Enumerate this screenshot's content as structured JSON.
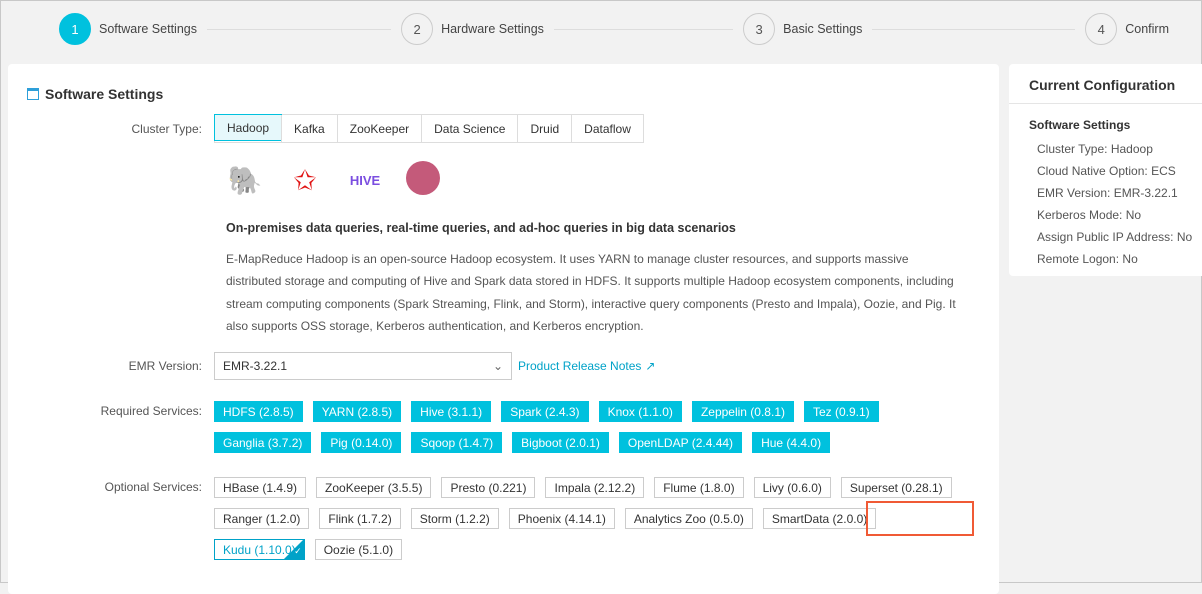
{
  "steps": [
    {
      "num": "1",
      "label": "Software Settings"
    },
    {
      "num": "2",
      "label": "Hardware Settings"
    },
    {
      "num": "3",
      "label": "Basic Settings"
    },
    {
      "num": "4",
      "label": "Confirm"
    }
  ],
  "main": {
    "title": "Software Settings",
    "cluster_type_label": "Cluster Type:",
    "cluster_types": [
      "Hadoop",
      "Kafka",
      "ZooKeeper",
      "Data Science",
      "Druid",
      "Dataflow"
    ],
    "heading": "On-premises data queries, real-time queries, and ad-hoc queries in big data scenarios",
    "description": "E-MapReduce Hadoop is an open-source Hadoop ecosystem. It uses YARN to manage cluster resources, and supports massive distributed storage and computing of Hive and Spark data stored in HDFS. It supports multiple Hadoop ecosystem components, including stream computing components (Spark Streaming, Flink, and Storm), interactive query components (Presto and Impala), Oozie, and Pig. It also supports OSS storage, Kerberos authentication, and Kerberos encryption.",
    "emr_version_label": "EMR Version:",
    "emr_version": "EMR-3.22.1",
    "release_notes": "Product Release Notes",
    "required_label": "Required Services:",
    "required": [
      "HDFS (2.8.5)",
      "YARN (2.8.5)",
      "Hive (3.1.1)",
      "Spark (2.4.3)",
      "Knox (1.1.0)",
      "Zeppelin (0.8.1)",
      "Tez (0.9.1)",
      "Ganglia (3.7.2)",
      "Pig (0.14.0)",
      "Sqoop (1.4.7)",
      "Bigboot (2.0.1)",
      "OpenLDAP (2.4.44)",
      "Hue (4.4.0)"
    ],
    "optional_label": "Optional Services:",
    "optional": [
      "HBase (1.4.9)",
      "ZooKeeper (3.5.5)",
      "Presto (0.221)",
      "Impala (2.12.2)",
      "Flume (1.8.0)",
      "Livy (0.6.0)",
      "Superset (0.28.1)",
      "Ranger (1.2.0)",
      "Flink (1.7.2)",
      "Storm (1.2.2)",
      "Phoenix (4.14.1)",
      "Analytics Zoo (0.5.0)",
      "SmartData (2.0.0)",
      "Kudu (1.10.0)",
      "Oozie (5.1.0)"
    ]
  },
  "side": {
    "title": "Current Configuration",
    "section": "Software Settings",
    "items": [
      {
        "k": "Cluster Type:",
        "v": "Hadoop"
      },
      {
        "k": "Cloud Native Option:",
        "v": "ECS"
      },
      {
        "k": "EMR Version:",
        "v": "EMR-3.22.1"
      },
      {
        "k": "Kerberos Mode:",
        "v": "No"
      },
      {
        "k": "Assign Public IP Address:",
        "v": "No"
      },
      {
        "k": "Remote Logon:",
        "v": "No"
      }
    ]
  }
}
